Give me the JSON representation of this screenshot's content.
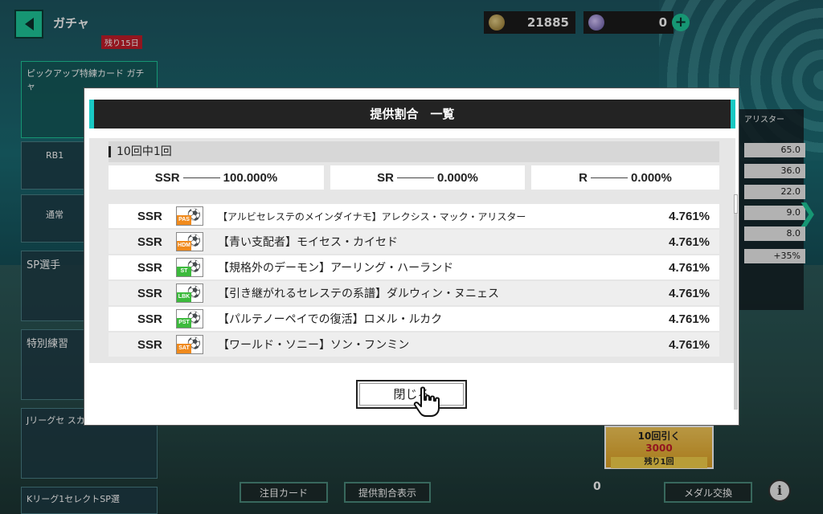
{
  "top_bar": {
    "title": "ガチャ",
    "days_badge": "残り15日",
    "coins": "21885",
    "gems": "0",
    "plus": "+"
  },
  "left_menu": [
    {
      "label": "ピックアップ特練カード ガチャ"
    },
    {
      "label": "RB1"
    },
    {
      "label": "通常"
    },
    {
      "label": "SP選手"
    },
    {
      "label": "特別練習"
    },
    {
      "label": "Jリーグセ スカウト"
    },
    {
      "label": "Kリーグ1セレクトSP選"
    }
  ],
  "right_bg": {
    "header": "アリスター",
    "values": [
      "65.0",
      "36.0",
      "22.0",
      "9.0",
      "8.0",
      "+35%"
    ]
  },
  "bottom_bar": {
    "featured_card": "注目カード",
    "rate_display": "提供割合表示",
    "draw10": "10回引く",
    "draw_cost": "3000",
    "remaining": "残り1回",
    "medal_count": "0",
    "medal_exchange": "メダル交換",
    "info": "i"
  },
  "modal": {
    "title": "提供割合　一覧",
    "section": "10回中1回",
    "summary": [
      {
        "rarity": "SSR",
        "rate": "100.000%"
      },
      {
        "rarity": "SR",
        "rate": "0.000%"
      },
      {
        "rarity": "R",
        "rate": "0.000%"
      }
    ],
    "rows": [
      {
        "rarity": "SSR",
        "pos": "PAS",
        "pos_color": "#f08a1c",
        "name": "【アルビセレステのメインダイナモ】アレクシス・マック・アリスター",
        "rate": "4.761%"
      },
      {
        "rarity": "SSR",
        "pos": "HDM",
        "pos_color": "#f08a1c",
        "name": "【青い支配者】モイセス・カイセド",
        "rate": "4.761%"
      },
      {
        "rarity": "SSR",
        "pos": "ST",
        "pos_color": "#3cba3c",
        "name": "【規格外のデーモン】アーリング・ハーランド",
        "rate": "4.761%"
      },
      {
        "rarity": "SSR",
        "pos": "LBK",
        "pos_color": "#3cba3c",
        "name": "【引き継がれるセレステの系譜】ダルウィン・ヌニェス",
        "rate": "4.761%"
      },
      {
        "rarity": "SSR",
        "pos": "PST",
        "pos_color": "#3cba3c",
        "name": "【パルテノーペイでの復活】ロメル・ルカク",
        "rate": "4.761%"
      },
      {
        "rarity": "SSR",
        "pos": "SAT",
        "pos_color": "#f08a1c",
        "name": "【ワールド・ソニー】ソン・フンミン",
        "rate": "4.761%"
      }
    ],
    "close_label": "閉じる"
  }
}
